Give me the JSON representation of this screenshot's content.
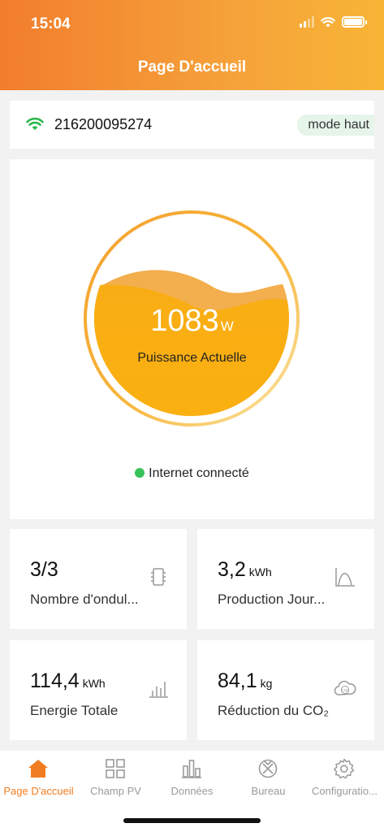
{
  "status_bar": {
    "time": "15:04"
  },
  "header": {
    "title": "Page D'accueil"
  },
  "device": {
    "serial": "216200095274",
    "mode": "mode haut",
    "wifi_icon": "wifi-icon"
  },
  "power": {
    "value": "1083",
    "unit": "W",
    "label": "Puissance Actuelle",
    "internet_status": "Internet connecté"
  },
  "stats": {
    "inverters": {
      "value": "3/3",
      "unit": "",
      "label": "Nombre d'ondul...",
      "icon": "inverter-icon"
    },
    "daily": {
      "value": "3,2",
      "unit": "kWh",
      "label": "Production Jour...",
      "icon": "curve-chart-icon"
    },
    "total": {
      "value": "114,4",
      "unit": "kWh",
      "label": "Energie Totale",
      "icon": "bar-chart-icon"
    },
    "co2": {
      "value": "84,1",
      "unit": "kg",
      "label": "Réduction du CO₂",
      "icon": "co2-cloud-icon"
    }
  },
  "tabs": [
    {
      "label": "Page D'accueil",
      "icon": "home-icon",
      "active": true
    },
    {
      "label": "Champ PV",
      "icon": "grid-icon",
      "active": false
    },
    {
      "label": "Données",
      "icon": "chart-icon",
      "active": false
    },
    {
      "label": "Bureau",
      "icon": "office-icon",
      "active": false
    },
    {
      "label": "Configuratio...",
      "icon": "gear-icon",
      "active": false
    }
  ],
  "colors": {
    "accent": "#f07d22",
    "header_start": "#f27d2d",
    "header_end": "#f8b536",
    "online": "#37c35a"
  }
}
